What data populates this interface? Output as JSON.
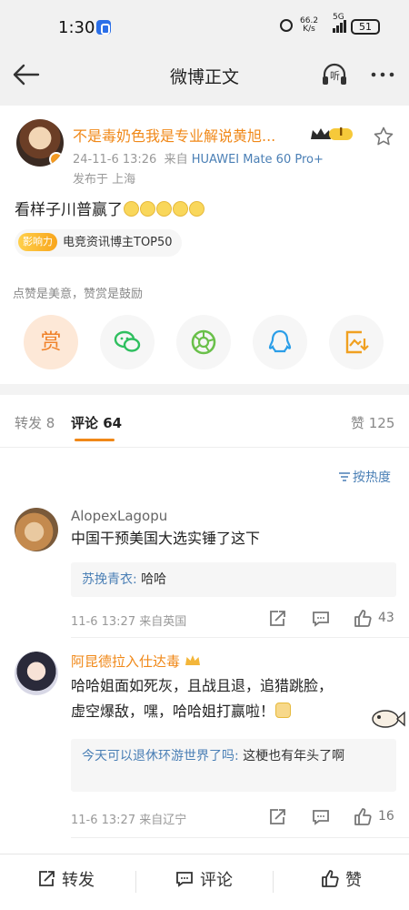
{
  "status_bar": {
    "time": "1:30",
    "speed_value": "66.2",
    "speed_unit": "K/s",
    "network": "5G",
    "battery": "51"
  },
  "nav": {
    "title": "微博正文",
    "listen_label": "听",
    "more_icon": "more-icon"
  },
  "post": {
    "author": "不是毒奶色我是专业解说黄旭...",
    "date": "24-11-6 13:26",
    "source_prefix": "来自",
    "source_device": "HUAWEI Mate 60 Pro+",
    "location": "发布于 上海",
    "text": "看样子川普赢了",
    "emoji_count": 5,
    "tag_logo": "影响力",
    "tag_text": "电竞资讯博主TOP50",
    "vip_badge": "I"
  },
  "reward": {
    "hint": "点赞是美意，赞赏是鼓励",
    "reward_label": "赏"
  },
  "tabs": {
    "repost": "转发 8",
    "comment": "评论 64",
    "like": "赞 125"
  },
  "sort_label": "按热度",
  "comments": [
    {
      "name": "AlopexLagopu",
      "name_color": "#666666",
      "text": "中国干预美国大选实锤了这下",
      "reply_name": "苏挽青衣:",
      "reply_text": "哈哈",
      "meta": "11-6 13:27  来自英国",
      "likes": "43"
    },
    {
      "name": "阿昆德拉入仕达毒",
      "name_color": "#f08818",
      "text_line1": "哈哈姐面如死灰，且战且退，追猎跳脸，",
      "text_line2": "虚空爆敌，嘿，哈哈姐打赢啦！",
      "reply_name": "今天可以退休环游世界了吗:",
      "reply_text": "这梗也有年头了啊",
      "meta": "11-6 13:27  来自辽宁",
      "likes": "16"
    }
  ],
  "bottom_bar": {
    "repost": "转发",
    "comment": "评论",
    "like": "赞"
  }
}
